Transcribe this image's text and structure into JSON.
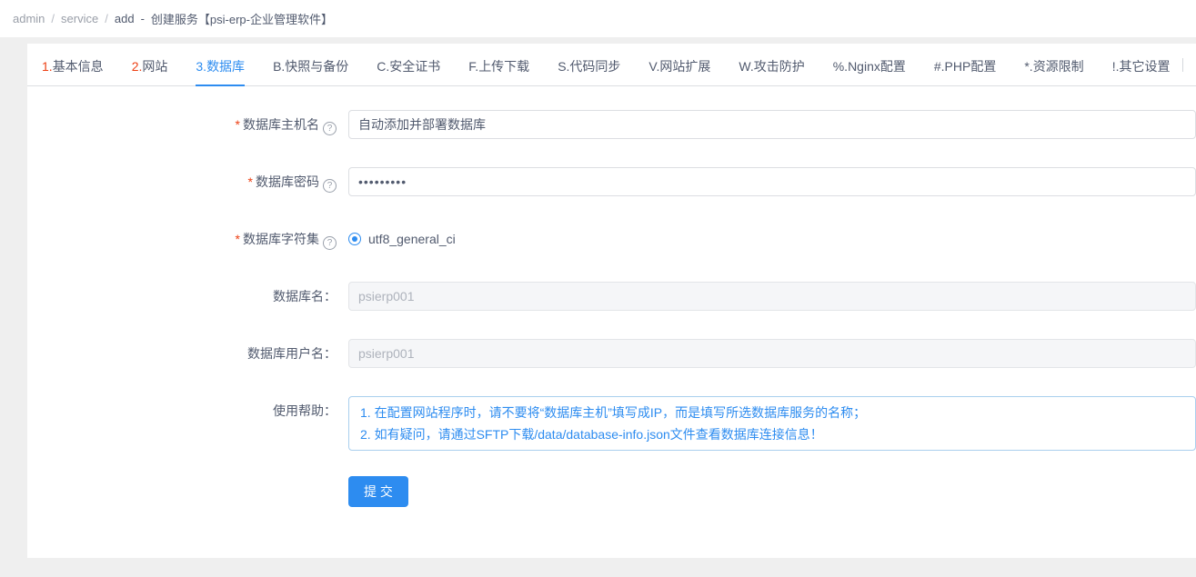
{
  "breadcrumb": {
    "items": [
      {
        "label": "admin"
      },
      {
        "label": "service"
      },
      {
        "label": "add"
      }
    ],
    "separator": "/",
    "dash": "-",
    "title": "创建服务【psi-erp-企业管理软件】"
  },
  "tabs": {
    "items": [
      {
        "prefix": "1.",
        "name": "基本信息"
      },
      {
        "prefix": "2.",
        "name": "网站"
      },
      {
        "prefix": "3.",
        "name": "数据库"
      },
      {
        "prefix": "B.",
        "name": "快照与备份"
      },
      {
        "prefix": "C.",
        "name": "安全证书"
      },
      {
        "prefix": "F.",
        "name": "上传下载"
      },
      {
        "prefix": "S.",
        "name": "代码同步"
      },
      {
        "prefix": "V.",
        "name": "网站扩展"
      },
      {
        "prefix": "W.",
        "name": "攻击防护"
      },
      {
        "prefix": "%.",
        "name": "Nginx配置"
      },
      {
        "prefix": "#.",
        "name": "PHP配置"
      },
      {
        "prefix": "*.",
        "name": "资源限制"
      },
      {
        "prefix": "!.",
        "name": "其它设置"
      }
    ],
    "active_index": 2
  },
  "form": {
    "help_icon": "?",
    "fields": [
      {
        "required": "*",
        "label": "数据库主机名",
        "value": "自动添加并部署数据库"
      },
      {
        "required": "*",
        "label": "数据库密码",
        "value": "•••••••••"
      },
      {
        "required": "*",
        "label": "数据库字符集",
        "value": "utf8_general_ci"
      },
      {
        "label": "数据库名：",
        "value": "psierp001"
      },
      {
        "label": "数据库用户名：",
        "value": "psierp001"
      },
      {
        "label": "使用帮助：",
        "lines": [
          "1. 在配置网站程序时，请不要将“数据库主机”填写成IP，而是填写所选数据库服务的名称；",
          "2. 如有疑问，请通过SFTP下载/data/database-info.json文件查看数据库连接信息！"
        ]
      }
    ],
    "submit_label": "提 交"
  },
  "colors": {
    "primary": "#2d8cf0",
    "danger": "#ed4014",
    "page_background": "#efefef"
  }
}
